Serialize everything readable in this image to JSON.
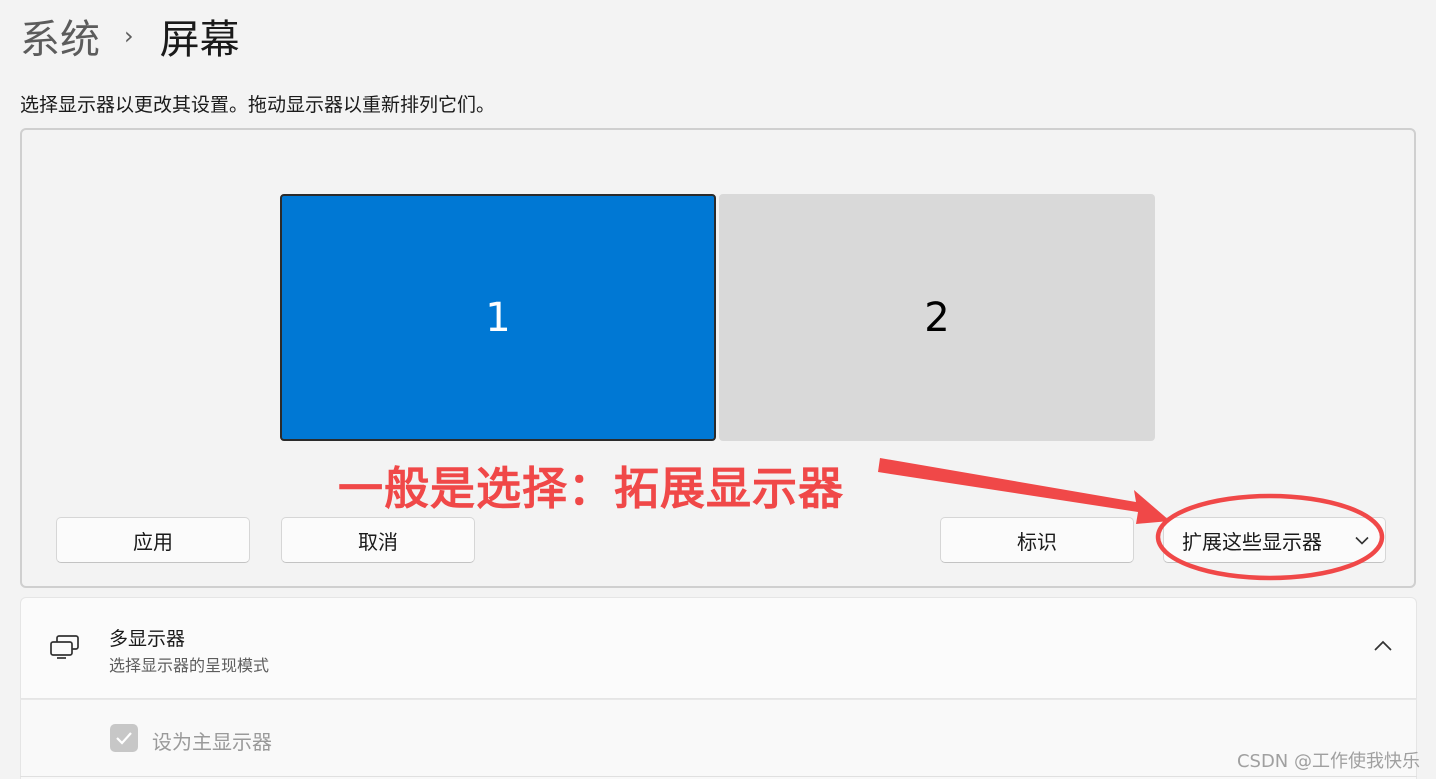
{
  "breadcrumb": {
    "parent": "系统",
    "separator": "›",
    "current": "屏幕"
  },
  "instruction": "选择显示器以更改其设置。拖动显示器以重新排列它们。",
  "arrangement": {
    "monitors": [
      {
        "label": "1",
        "selected": true,
        "color": "#0078d4"
      },
      {
        "label": "2",
        "selected": false,
        "color": "#d9d9d9"
      }
    ]
  },
  "buttons": {
    "apply": "应用",
    "cancel": "取消",
    "identify": "标识",
    "mode_selected": "扩展这些显示器",
    "mode_icon": "chevron-down-icon"
  },
  "annotation": {
    "text": "一般是选择：拓展显示器",
    "color": "#f04848"
  },
  "multi_display": {
    "icon": "multi-monitor-icon",
    "title": "多显示器",
    "subtitle": "选择显示器的呈现模式",
    "expanded": true,
    "collapse_icon": "chevron-up-icon",
    "primary_checkbox_label": "设为主显示器",
    "primary_checked": true,
    "primary_disabled": true
  },
  "watermark": "CSDN @工作使我快乐"
}
